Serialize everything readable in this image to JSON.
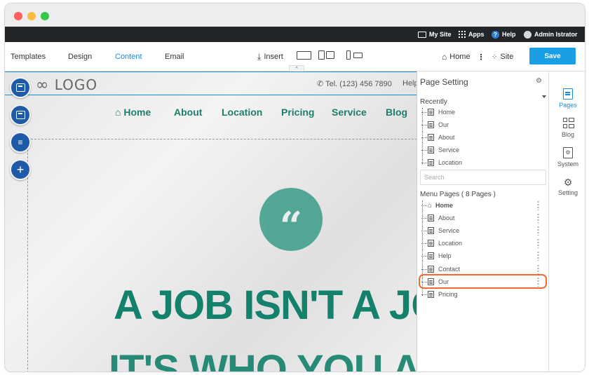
{
  "topbar": {
    "my_site": "My Site",
    "apps": "Apps",
    "help": "Help",
    "user": "Admin Istrator"
  },
  "toolbar": {
    "tabs": [
      "Templates",
      "Design",
      "Content",
      "Email"
    ],
    "active_tab": "Content",
    "insert": "Insert",
    "home": "Home",
    "site": "Site",
    "save": "Save",
    "accent_color": "#1a9ee6"
  },
  "site": {
    "logo": "LOGO",
    "phone": "Tel. (123) 456 7890",
    "help_cut": "Help",
    "nav": [
      "Home",
      "About",
      "Location",
      "Pricing",
      "Service",
      "Blog"
    ],
    "quote_glyph": "“",
    "headline_line1": "A JOB ISN'T A JO",
    "headline_line2": "IT'S WHO YOU A",
    "brand_color": "#13816c"
  },
  "panel": {
    "title": "Page Setting",
    "recently_label": "Recently",
    "recently": [
      "Home",
      "Our",
      "About",
      "Service",
      "Location"
    ],
    "search_placeholder": "Search",
    "menu_pages_label": "Menu Pages ( 8 Pages )",
    "menu_pages": [
      "Home",
      "About",
      "Service",
      "Location",
      "Help",
      "Contact",
      "Our",
      "Pricing"
    ],
    "highlighted_page": "Our",
    "highlight_color": "#f06a32"
  },
  "rightbar": {
    "items": [
      "Pages",
      "Blog",
      "System",
      "Setting"
    ],
    "active": "Pages"
  }
}
